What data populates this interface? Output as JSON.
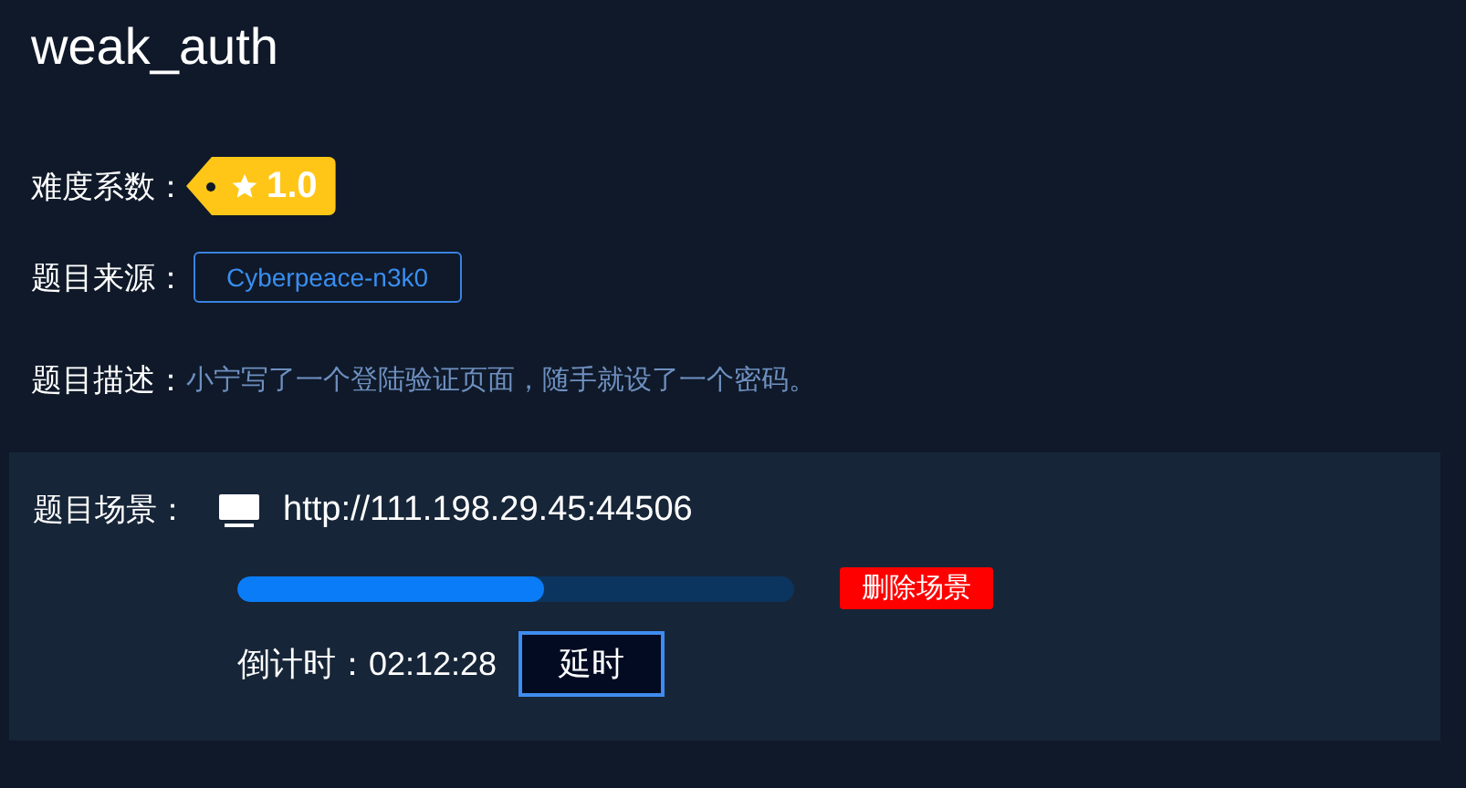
{
  "title": "weak_auth",
  "info": [
    {
      "kind": "difficulty",
      "label": "难度系数：",
      "value": "1.0"
    },
    {
      "kind": "source",
      "label": "题目来源：",
      "value": "Cyberpeace-n3k0"
    },
    {
      "kind": "description",
      "label": "题目描述：",
      "value": "小宁写了一个登陆验证页面，随手就设了一个密码。"
    }
  ],
  "scene": {
    "label": "题目场景：",
    "url": "http://111.198.29.45:44506",
    "level": 0.55,
    "delete_button": "删除场景",
    "countdown_label": "倒计时：",
    "countdown": "02:12:28",
    "extend_button": "延时"
  }
}
